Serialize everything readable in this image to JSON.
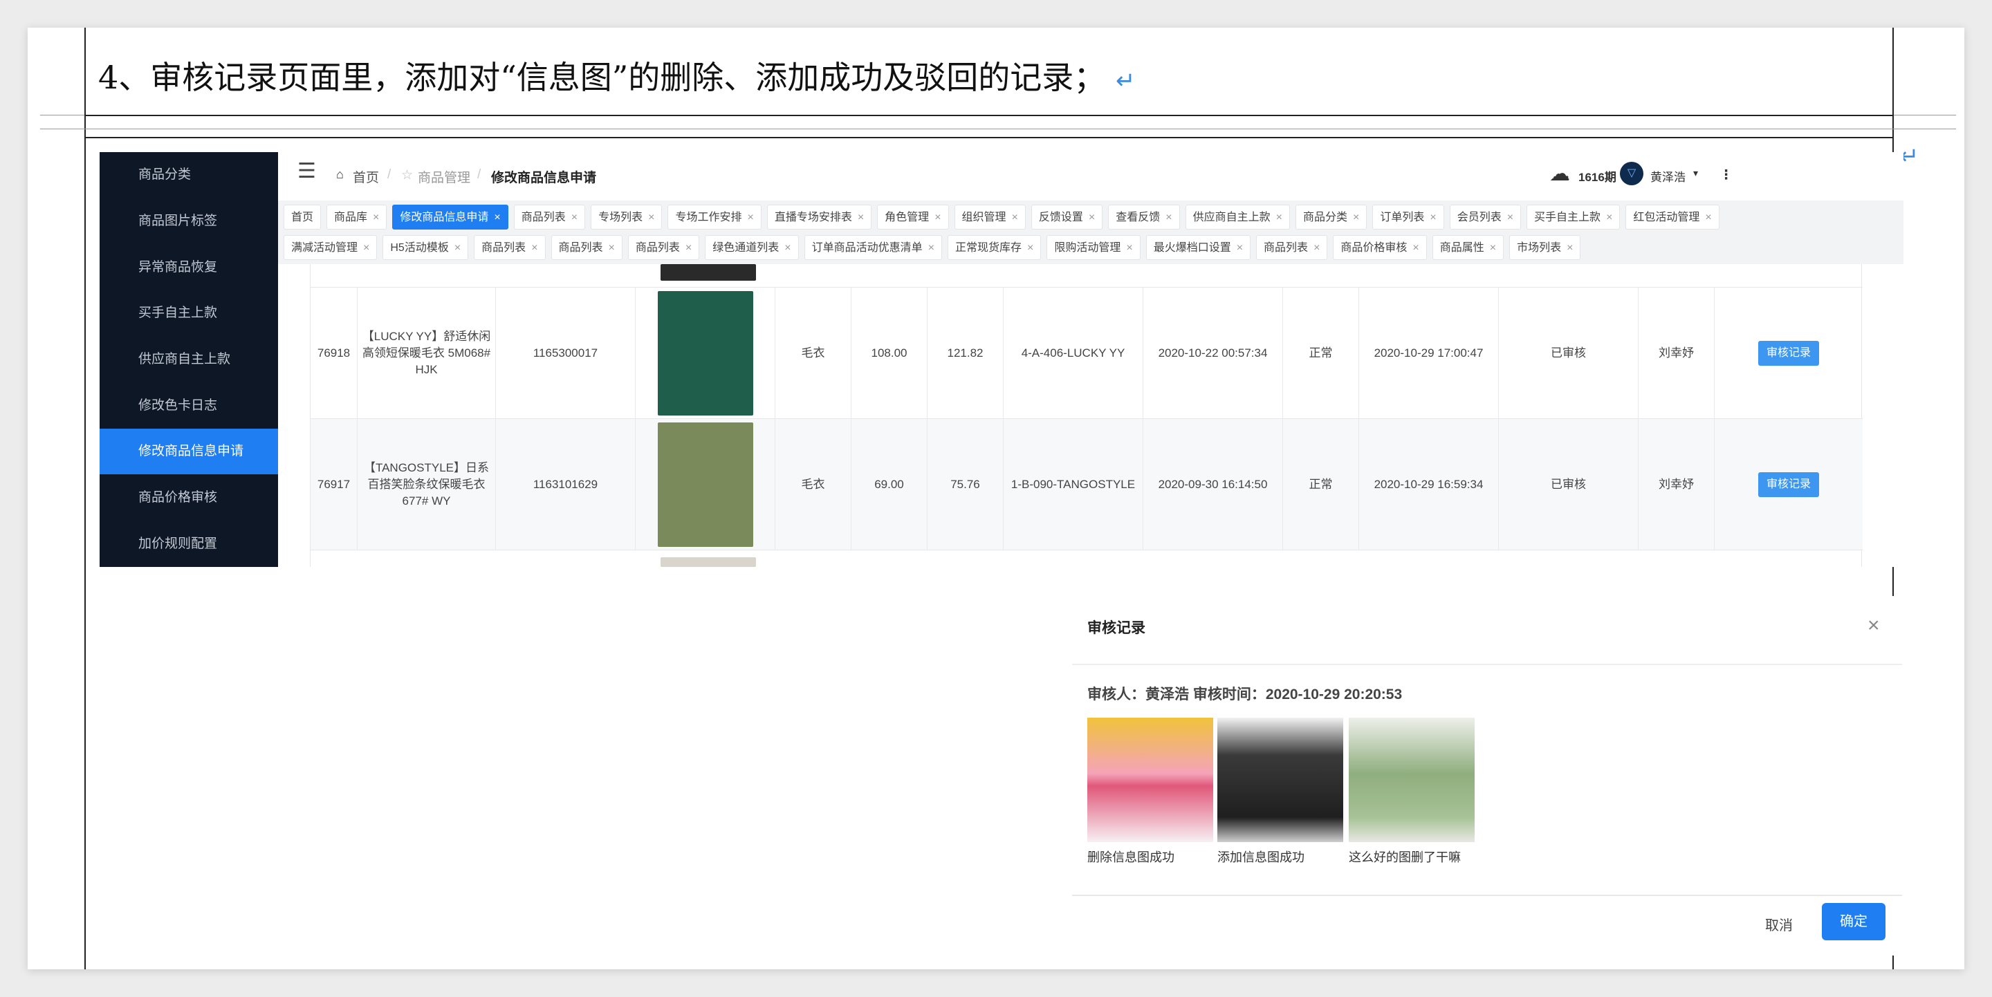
{
  "document": {
    "heading": "4、审核记录页面里，添加对“信息图”的删除、添加成功及驳回的记录；",
    "paragraph_mark": "↵"
  },
  "sidebar": {
    "items": [
      {
        "label": "商品分类",
        "active": false
      },
      {
        "label": "商品图片标签",
        "active": false
      },
      {
        "label": "异常商品恢复",
        "active": false
      },
      {
        "label": "买手自主上款",
        "active": false
      },
      {
        "label": "供应商自主上款",
        "active": false
      },
      {
        "label": "修改色卡日志",
        "active": false
      },
      {
        "label": "修改商品信息申请",
        "active": true
      },
      {
        "label": "商品价格审核",
        "active": false
      },
      {
        "label": "加价规则配置",
        "active": false
      }
    ]
  },
  "topbar": {
    "menu_icon": "hamburger-icon",
    "breadcrumb": [
      "首页",
      "商品管理",
      "修改商品信息申请"
    ],
    "home_icon": "home-icon",
    "module_icon": "star-icon",
    "download_icon": "cloud-download-icon",
    "period": "1616期",
    "user": "黄泽浩",
    "avatar_icon": "triangle-avatar-icon"
  },
  "tags": {
    "row1": [
      {
        "label": "首页",
        "closable": false,
        "active": false
      },
      {
        "label": "商品库",
        "closable": true,
        "active": false
      },
      {
        "label": "修改商品信息申请",
        "closable": true,
        "active": true
      },
      {
        "label": "商品列表",
        "closable": true,
        "active": false
      },
      {
        "label": "专场列表",
        "closable": true,
        "active": false
      },
      {
        "label": "专场工作安排",
        "closable": true,
        "active": false
      },
      {
        "label": "直播专场安排表",
        "closable": true,
        "active": false
      },
      {
        "label": "角色管理",
        "closable": true,
        "active": false
      },
      {
        "label": "组织管理",
        "closable": true,
        "active": false
      },
      {
        "label": "反馈设置",
        "closable": true,
        "active": false
      },
      {
        "label": "查看反馈",
        "closable": true,
        "active": false
      },
      {
        "label": "供应商自主上款",
        "closable": true,
        "active": false
      },
      {
        "label": "商品分类",
        "closable": true,
        "active": false
      },
      {
        "label": "订单列表",
        "closable": true,
        "active": false
      },
      {
        "label": "会员列表",
        "closable": true,
        "active": false
      },
      {
        "label": "买手自主上款",
        "closable": true,
        "active": false
      },
      {
        "label": "红包活动管理",
        "closable": true,
        "active": false
      }
    ],
    "row2": [
      {
        "label": "满减活动管理",
        "closable": true,
        "active": false
      },
      {
        "label": "H5活动模板",
        "closable": true,
        "active": false
      },
      {
        "label": "商品列表",
        "closable": true,
        "active": false
      },
      {
        "label": "商品列表",
        "closable": true,
        "active": false
      },
      {
        "label": "商品列表",
        "closable": true,
        "active": false
      },
      {
        "label": "绿色通道列表",
        "closable": true,
        "active": false
      },
      {
        "label": "订单商品活动优惠清单",
        "closable": true,
        "active": false
      },
      {
        "label": "正常现货库存",
        "closable": true,
        "active": false
      },
      {
        "label": "限购活动管理",
        "closable": true,
        "active": false
      },
      {
        "label": "最火爆档口设置",
        "closable": true,
        "active": false
      },
      {
        "label": "商品列表",
        "closable": true,
        "active": false
      },
      {
        "label": "商品价格审核",
        "closable": true,
        "active": false
      },
      {
        "label": "商品属性",
        "closable": true,
        "active": false
      },
      {
        "label": "市场列表",
        "closable": true,
        "active": false
      }
    ],
    "close_glyph": "×"
  },
  "table": {
    "rows": [
      {
        "id": "76918",
        "name": "【LUCKY YY】舒适休闲高领短保暖毛衣 5M068# HJK",
        "code": "1165300017",
        "thumb_color": "#1f5e4a",
        "category": "毛衣",
        "price": "108.00",
        "price2": "121.82",
        "sku": "4-A-406-LUCKY YY",
        "created": "2020-10-22 00:57:34",
        "status": "正常",
        "updated": "2020-10-29 17:00:47",
        "audit_status": "已审核",
        "auditor": "刘幸妤",
        "action": "审核记录"
      },
      {
        "id": "76917",
        "name": "【TANGOSTYLE】日系百搭笑脸条纹保暖毛衣 677# WY",
        "code": "1163101629",
        "thumb_color": "#7a8a5a",
        "category": "毛衣",
        "price": "69.00",
        "price2": "75.76",
        "sku": "1-B-090-TANGOSTYLE",
        "created": "2020-09-30 16:14:50",
        "status": "正常",
        "updated": "2020-10-29 16:59:34",
        "audit_status": "已审核",
        "auditor": "刘幸妤",
        "action": "审核记录"
      }
    ]
  },
  "dialog": {
    "title": "审核记录",
    "close_icon": "close-icon",
    "meta": "审核人：黄泽浩    审核时间：2020-10-29 20:20:53",
    "images": [
      {
        "caption": "删除信息图成功",
        "color": "#e0587a"
      },
      {
        "caption": "添加信息图成功",
        "color": "#3a3a3a"
      },
      {
        "caption": "这么好的图删了干嘛",
        "color": "#8fae7e"
      }
    ],
    "cancel": "取消",
    "ok": "确定"
  }
}
